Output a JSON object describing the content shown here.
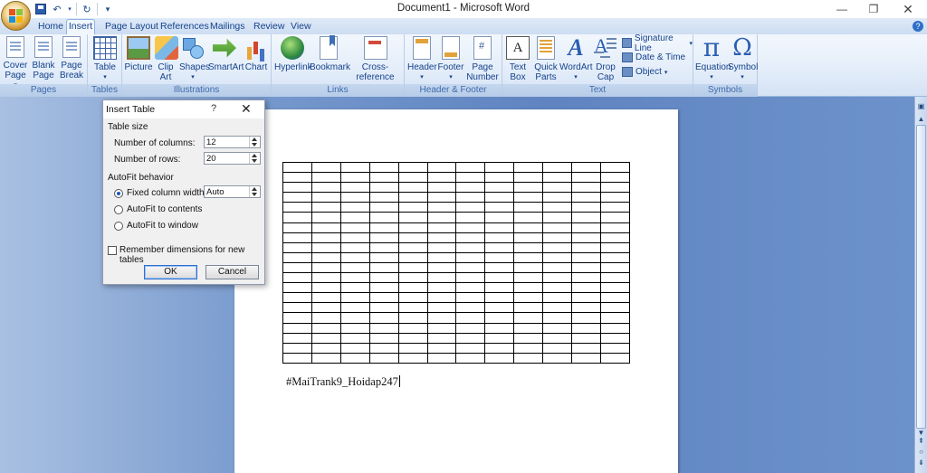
{
  "window": {
    "title": "Document1 - Microsoft Word"
  },
  "tabs": [
    {
      "label": "Home",
      "active": false
    },
    {
      "label": "Insert",
      "active": true
    },
    {
      "label": "Page Layout",
      "active": false
    },
    {
      "label": "References",
      "active": false
    },
    {
      "label": "Mailings",
      "active": false
    },
    {
      "label": "Review",
      "active": false
    },
    {
      "label": "View",
      "active": false
    }
  ],
  "ribbon": {
    "pages": {
      "label": "Pages",
      "cover_page": "Cover Page",
      "blank_page": "Blank Page",
      "page_break": "Page Break"
    },
    "tables": {
      "label": "Tables",
      "table": "Table"
    },
    "illustrations": {
      "label": "Illustrations",
      "picture": "Picture",
      "clip_art": "Clip Art",
      "shapes": "Shapes",
      "smartart": "SmartArt",
      "chart": "Chart"
    },
    "links": {
      "label": "Links",
      "hyperlink": "Hyperlink",
      "bookmark": "Bookmark",
      "cross_reference": "Cross-reference"
    },
    "header_footer": {
      "label": "Header & Footer",
      "header": "Header",
      "footer": "Footer",
      "page_number": "Page Number"
    },
    "text": {
      "label": "Text",
      "text_box": "Text Box",
      "quick_parts": "Quick Parts",
      "wordart": "WordArt",
      "drop_cap": "Drop Cap",
      "signature_line": "Signature Line",
      "date_time": "Date & Time",
      "object": "Object"
    },
    "symbols": {
      "label": "Symbols",
      "equation": "Equation",
      "symbol": "Symbol"
    }
  },
  "dialog": {
    "title": "Insert Table",
    "help": "?",
    "table_size": "Table size",
    "columns_label": "Number of columns:",
    "columns_value": "12",
    "rows_label": "Number of rows:",
    "rows_value": "20",
    "autofit_behavior": "AutoFit behavior",
    "fixed_width_label": "Fixed column width:",
    "fixed_width_value": "Auto",
    "autofit_contents": "AutoFit to contents",
    "autofit_window": "AutoFit to window",
    "remember": "Remember dimensions for new tables",
    "ok": "OK",
    "cancel": "Cancel"
  },
  "document": {
    "text": "#MaiTrank9_Hoidap247",
    "table_columns": 12,
    "table_rows": 20
  },
  "colors": {
    "ribbon_text": "#15428b",
    "workspace": "#6d92cb"
  }
}
